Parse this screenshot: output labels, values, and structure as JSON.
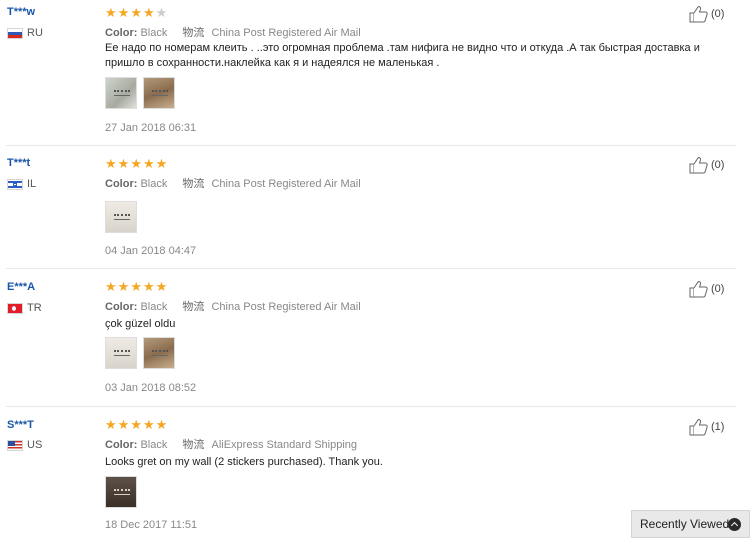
{
  "reviews": [
    {
      "user": "T***w",
      "country": "RU",
      "rating": 4,
      "color_label": "Color:",
      "color_value": "Black",
      "shipping_label": "物流",
      "shipping_value": "China Post Registered Air Mail",
      "text": "Ее надо по номерам клеить . ..это огромная проблема .там нифига не видно что и откуда .А так быстрая доставка и пришло в сохранности.наклейка как я и надеялся не маленькая .",
      "photos": 2,
      "date": "27 Jan 2018 06:31",
      "helpful": "(0)"
    },
    {
      "user": "T***t",
      "country": "IL",
      "rating": 5,
      "color_label": "Color:",
      "color_value": "Black",
      "shipping_label": "物流",
      "shipping_value": "China Post Registered Air Mail",
      "text": "",
      "photos": 1,
      "date": "04 Jan 2018 04:47",
      "helpful": "(0)"
    },
    {
      "user": "E***A",
      "country": "TR",
      "rating": 5,
      "color_label": "Color:",
      "color_value": "Black",
      "shipping_label": "物流",
      "shipping_value": "China Post Registered Air Mail",
      "text": "çok güzel oldu",
      "photos": 2,
      "date": "03 Jan 2018 08:52",
      "helpful": "(0)"
    },
    {
      "user": "S***T",
      "country": "US",
      "rating": 5,
      "color_label": "Color:",
      "color_value": "Black",
      "shipping_label": "物流",
      "shipping_value": "AliExpress Standard Shipping",
      "text": "Looks gret on my wall (2 stickers purchased). Thank you.",
      "photos": 1,
      "date": "18 Dec 2017 11:51",
      "helpful": "(1)"
    }
  ],
  "recently_viewed": {
    "label": "Recently Viewed",
    "icon": "chevron-up-icon"
  },
  "colors": {
    "username": "#1a56a8",
    "star_on": "#f5a623",
    "star_off": "#cccccc"
  }
}
